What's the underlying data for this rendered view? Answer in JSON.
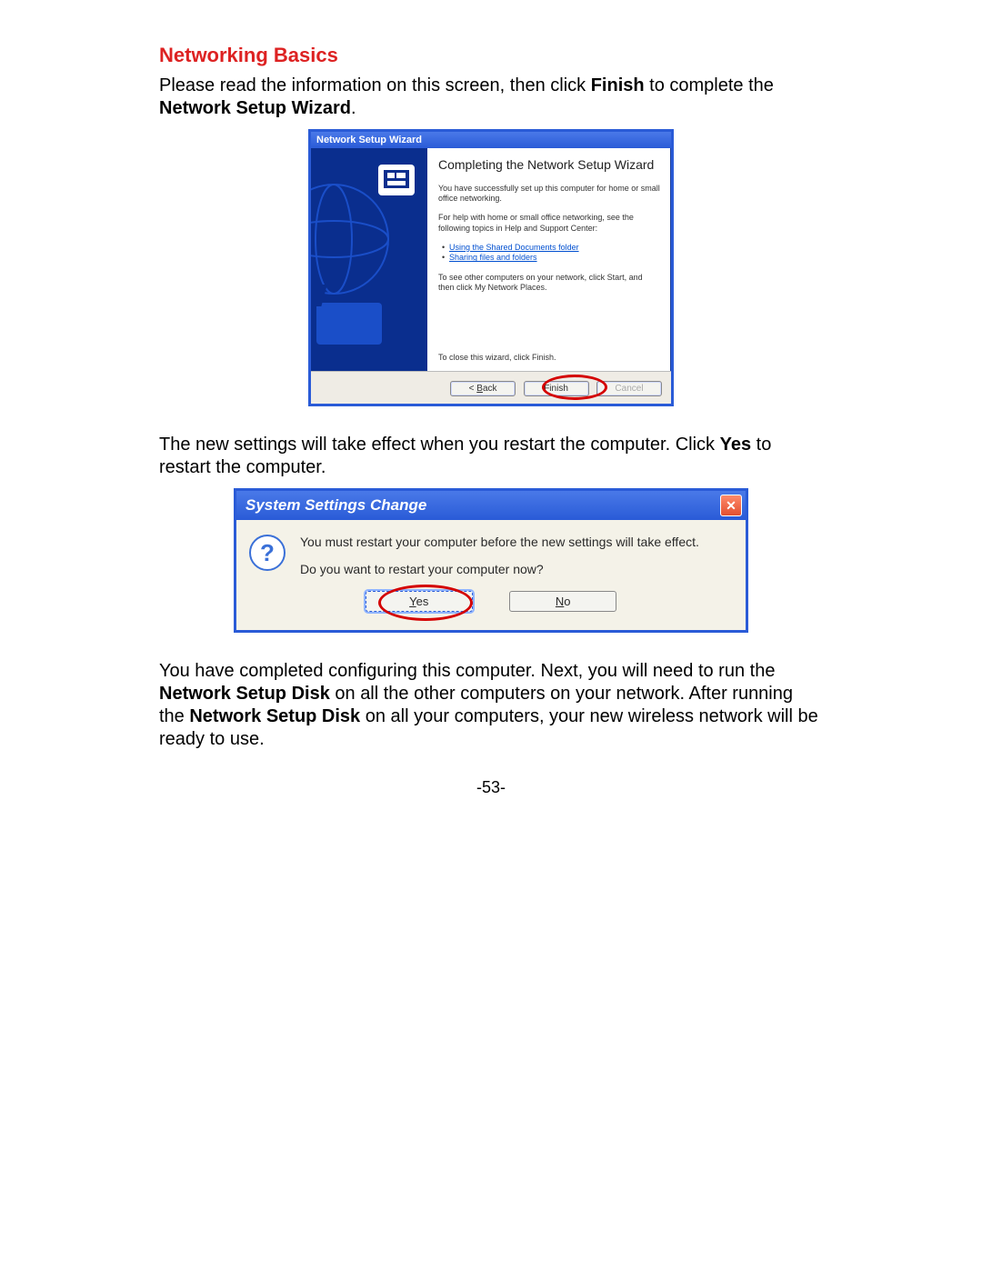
{
  "page_number": "-53-",
  "section_title": "Networking Basics",
  "para1_pre": "Please read the information on this screen, then click ",
  "para1_bold1": "Finish",
  "para1_mid": " to complete the ",
  "para1_bold2": "Network Setup Wizard",
  "para1_end": ".",
  "wizard": {
    "title": "Network Setup Wizard",
    "heading": "Completing the Network Setup Wizard",
    "p1": "You have successfully set up this computer for home or small office networking.",
    "p2": "For help with home or small office networking, see the following topics in Help and Support Center:",
    "link1": "Using the Shared Documents folder",
    "link2": "Sharing files and folders",
    "p3": "To see other computers on your network, click Start, and then click My Network Places.",
    "p_close": "To close this wizard, click Finish.",
    "btn_back_pre": "< ",
    "btn_back_u": "B",
    "btn_back_post": "ack",
    "btn_finish": "Finish",
    "btn_cancel": "Cancel"
  },
  "para2_pre": "The new settings will take effect when you restart the computer.    Click ",
  "para2_bold": "Yes",
  "para2_end": " to restart the computer.",
  "dialog2": {
    "title": "System Settings Change",
    "line1": "You must restart your computer before the new settings will take effect.",
    "line2": "Do you want to restart your computer now?",
    "yes_u": "Y",
    "yes_post": "es",
    "no_u": "N",
    "no_post": "o"
  },
  "para3_a": "You have completed configuring this computer.    Next, you will need to run the ",
  "para3_b": "Network Setup Disk",
  "para3_c": " on all the other computers on your network. After running the ",
  "para3_d": "Network Setup Disk",
  "para3_e": " on all your computers, your new wireless network will be ready to use."
}
